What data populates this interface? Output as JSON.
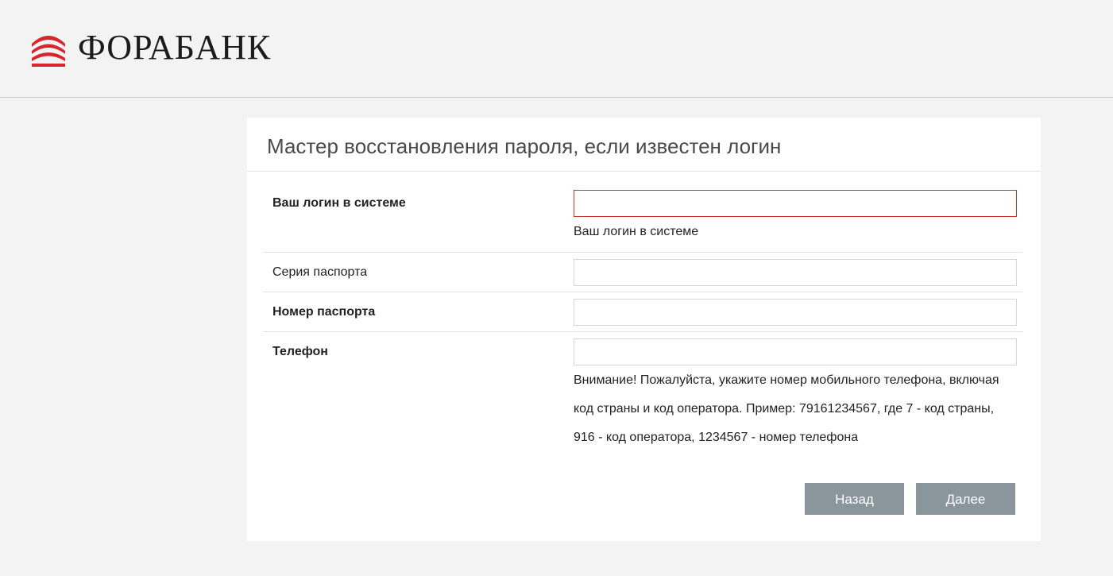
{
  "header": {
    "logo_text": "ФОРАБАНК"
  },
  "wizard": {
    "title": "Мастер восстановления пароля, если известен логин",
    "fields": {
      "login": {
        "label": "Ваш логин в системе",
        "value": "",
        "hint": "Ваш логин в системе"
      },
      "passport_series": {
        "label": "Серия паспорта",
        "value": ""
      },
      "passport_number": {
        "label": "Номер паспорта",
        "value": ""
      },
      "phone": {
        "label": "Телефон",
        "value": "",
        "warning": "Внимание! Пожалуйста, укажите номер мобильного телефона, включая код страны и код оператора. Пример: 79161234567, где 7 - код страны, 916 - код оператора, 1234567 - номер телефона"
      }
    },
    "buttons": {
      "back_label": "Назад",
      "next_label": "Далее"
    }
  },
  "colors": {
    "brand_red": "#d9262c",
    "button_bg": "#8a959c",
    "error_border": "#c0392b",
    "page_bg": "#f3f3f3"
  }
}
